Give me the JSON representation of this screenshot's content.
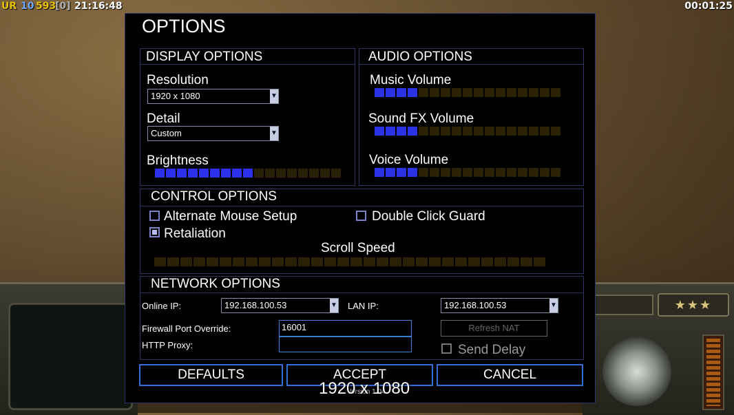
{
  "hud": {
    "rank_stars": "★★★",
    "status": {
      "ur": "UR",
      "level": "10",
      "money": "593",
      "bracket": "[0]",
      "clock": "21:16:48"
    },
    "timer": "00:01:25"
  },
  "dialog": {
    "title": "OPTIONS",
    "display": {
      "heading": "DISPLAY OPTIONS",
      "resolution_label": "Resolution",
      "resolution_value": "1920 x 1080",
      "detail_label": "Detail",
      "detail_value": "Custom",
      "brightness_label": "Brightness",
      "brightness_level": 9,
      "brightness_segments": 17
    },
    "audio": {
      "heading": "AUDIO OPTIONS",
      "music_label": "Music Volume",
      "music_level": 4,
      "sfx_label": "Sound FX Volume",
      "sfx_level": 4,
      "voice_label": "Voice Volume",
      "voice_level": 4,
      "segments": 17
    },
    "control": {
      "heading": "CONTROL OPTIONS",
      "alt_mouse_label": "Alternate Mouse Setup",
      "alt_mouse_checked": false,
      "double_click_label": "Double Click Guard",
      "double_click_checked": false,
      "retaliation_label": "Retaliation",
      "retaliation_checked": true,
      "scroll_label": "Scroll Speed",
      "scroll_level": 0,
      "scroll_segments": 30
    },
    "network": {
      "heading": "NETWORK OPTIONS",
      "online_ip_label": "Online IP:",
      "online_ip_value": "192.168.100.53",
      "lan_ip_label": "LAN IP:",
      "lan_ip_value": "192.168.100.53",
      "firewall_label": "Firewall Port Override:",
      "firewall_value": "16001",
      "http_proxy_label": "HTTP Proxy:",
      "http_proxy_value": "",
      "refresh_nat_label": "Refresh NAT",
      "send_delay_label": "Send Delay",
      "send_delay_checked": false
    },
    "buttons": {
      "defaults": "DEFAULTS",
      "accept": "ACCEPT",
      "cancel": "CANCEL"
    },
    "version": "Version 1.04"
  },
  "resolution_overlay": "1920 x 1080",
  "colors": {
    "accent_blue": "#2a33e8",
    "border_blue": "#2c3566",
    "slider_off": "#2a2106"
  }
}
